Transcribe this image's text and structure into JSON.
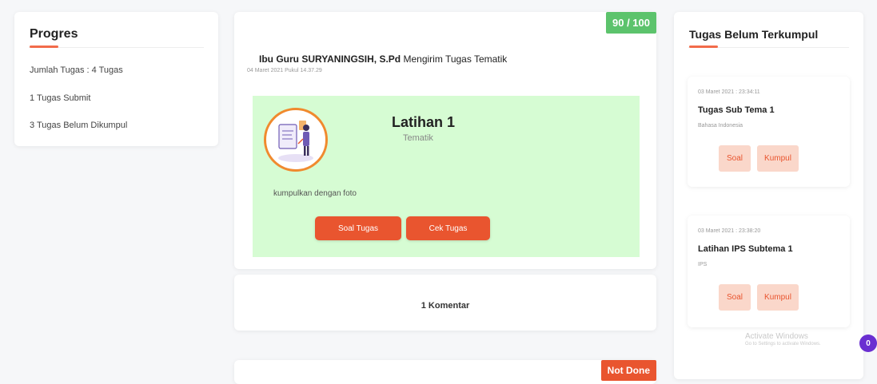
{
  "progress": {
    "title": "Progres",
    "stats": [
      "Jumlah Tugas : 4 Tugas",
      "1 Tugas Submit",
      "3 Tugas Belum Dikumpul"
    ]
  },
  "task": {
    "score": "90 / 100",
    "sender_name": "Ibu Guru SURYANINGSIH, S.Pd",
    "sender_action": "Mengirim Tugas Tematik",
    "sent_time": "04 Maret 2021 Pukul 14.37.29",
    "name": "Latihan 1",
    "subject": "Tematik",
    "note": "kumpulkan dengan foto",
    "soal_button": "Soal Tugas",
    "cek_button": "Cek Tugas",
    "comments": "1 Komentar"
  },
  "next_task": {
    "badge": "Not Done"
  },
  "pending": {
    "title": "Tugas Belum Terkumpul",
    "items": [
      {
        "date": "03 Maret 2021 : 23:34:11",
        "name": "Tugas Sub Tema 1",
        "subject": "Bahasa Indonesia",
        "soal": "Soal",
        "kumpul": "Kumpul"
      },
      {
        "date": "03 Maret 2021 : 23:38:20",
        "name": "Latihan IPS Subtema 1",
        "subject": "IPS",
        "soal": "Soal",
        "kumpul": "Kumpul"
      }
    ]
  },
  "watermark": {
    "line1": "Activate Windows",
    "line2": "Go to Settings to activate Windows."
  },
  "notification_count": "0",
  "colors": {
    "accent": "#e9552f",
    "success": "#5cc36c",
    "task_bg": "#d6fcd3",
    "soft_button": "#fad7ca"
  }
}
